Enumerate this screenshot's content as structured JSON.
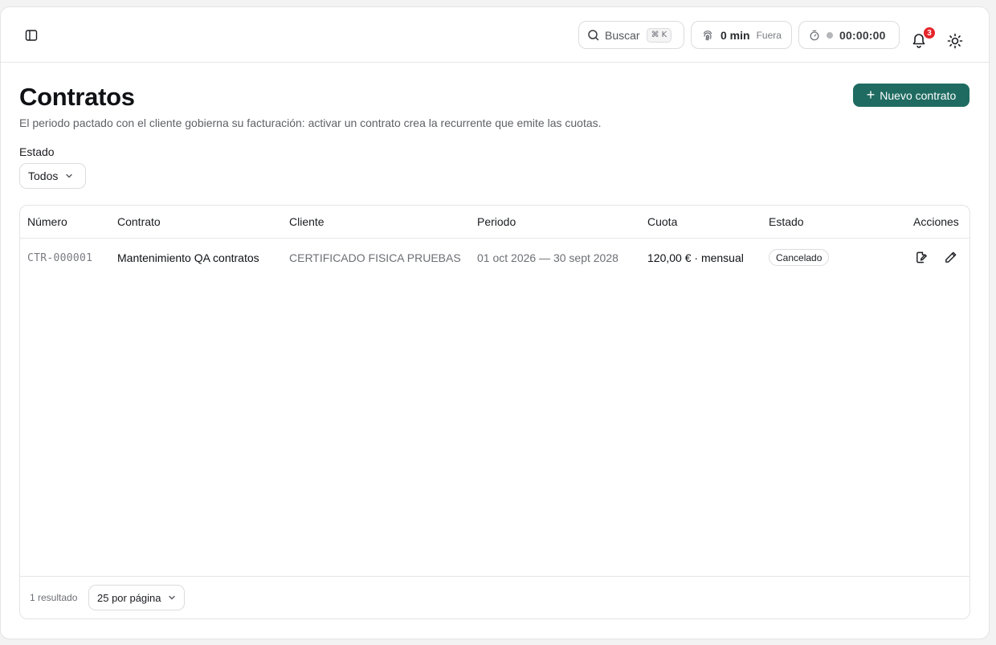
{
  "topbar": {
    "search_label": "Buscar",
    "search_shortcut_key": "K",
    "presence_value": "0 min",
    "presence_status": "Fuera",
    "timer_value": "00:00:00",
    "notification_count": "3"
  },
  "page": {
    "title": "Contratos",
    "subtitle": "El periodo pactado con el cliente gobierna su facturación: activar un contrato crea la recurrente que emite las cuotas.",
    "new_button": "Nuevo contrato"
  },
  "filter": {
    "label": "Estado",
    "value": "Todos"
  },
  "table": {
    "columns": [
      "Número",
      "Contrato",
      "Cliente",
      "Periodo",
      "Cuota",
      "Estado",
      "Acciones"
    ],
    "rows": [
      {
        "numero": "CTR-000001",
        "contrato": "Mantenimiento QA contratos",
        "cliente": "CERTIFICADO FISICA PRUEBAS",
        "periodo": "01 oct 2026 — 30 sept 2028",
        "cuota": "120,00 € · mensual",
        "estado": "Cancelado"
      }
    ],
    "footer": {
      "result_count": "1 resultado",
      "page_size": "25 por página"
    }
  },
  "colors": {
    "accent": "#1f6b61",
    "badge": "#e5252a"
  },
  "icons": [
    "sidebar-toggle-icon",
    "search-icon",
    "fingerprint-icon",
    "stopwatch-icon",
    "bell-icon",
    "sun-icon",
    "plus-icon",
    "chevron-down-icon",
    "view-document-icon",
    "pencil-icon"
  ]
}
